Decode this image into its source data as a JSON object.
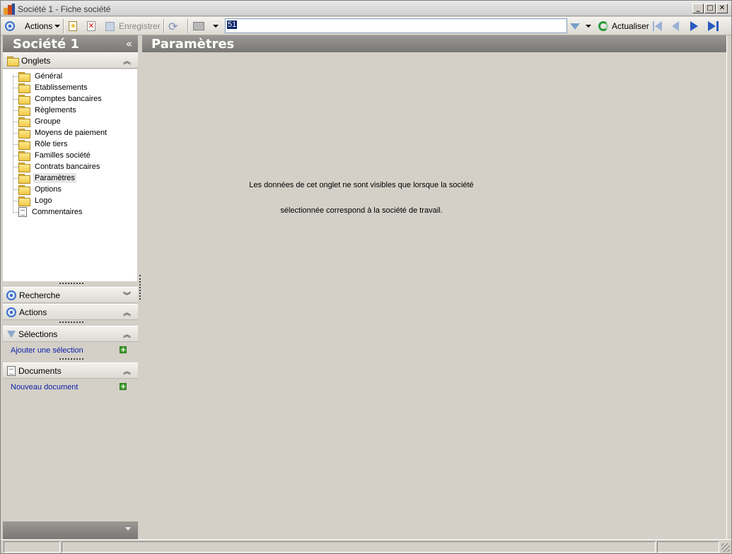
{
  "window": {
    "title": "Société 1 -  Fiche société"
  },
  "toolbar": {
    "actions_label": "Actions",
    "save_label": "Enregistrer",
    "search_value": "51",
    "refresh_label": "Actualiser"
  },
  "sidebar": {
    "company_title": "Société 1",
    "tabs_header": "Onglets",
    "tabs": [
      {
        "label": "Général",
        "icon": "folder-icon"
      },
      {
        "label": "Etablissements",
        "icon": "folder-icon"
      },
      {
        "label": "Comptes bancaires",
        "icon": "folder-icon"
      },
      {
        "label": "Règlements",
        "icon": "folder-icon"
      },
      {
        "label": "Groupe",
        "icon": "folder-icon"
      },
      {
        "label": "Moyens de paiement",
        "icon": "folder-icon"
      },
      {
        "label": "Rôle tiers",
        "icon": "folder-icon"
      },
      {
        "label": "Familles société",
        "icon": "folder-icon"
      },
      {
        "label": "Contrats bancaires",
        "icon": "folder-icon"
      },
      {
        "label": "Paramètres",
        "icon": "folder-open-icon",
        "selected": true
      },
      {
        "label": "Options",
        "icon": "folder-icon"
      },
      {
        "label": "Logo",
        "icon": "folder-icon"
      },
      {
        "label": "Commentaires",
        "icon": "document-icon"
      }
    ],
    "search_header": "Recherche",
    "actions_header": "Actions",
    "selections_header": "Sélections",
    "add_selection": "Ajouter une sélection",
    "documents_header": "Documents",
    "new_document": "Nouveau document"
  },
  "main": {
    "title": "Paramètres",
    "message_line1": "Les données de cet onglet ne sont visibles que lorsque la société",
    "message_line2": "sélectionnée correspond à la société de travail."
  },
  "colors": {
    "header_gray": "#8a8884",
    "link_blue": "#0a1fa8",
    "accent_blue": "#3a6ec8",
    "add_green": "#3a9a2a"
  }
}
